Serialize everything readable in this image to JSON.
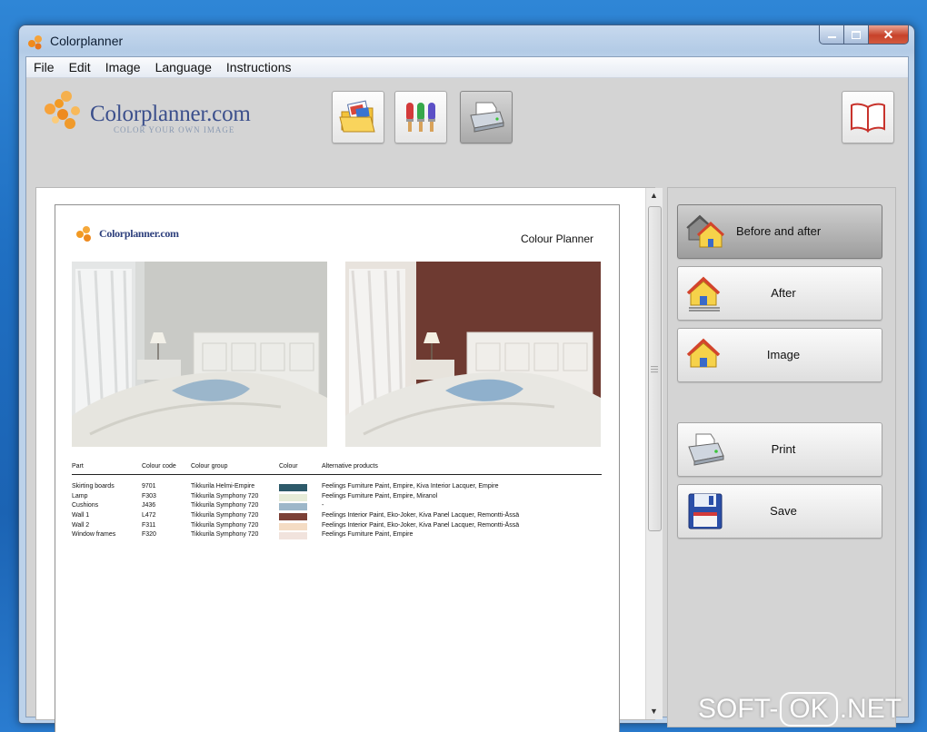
{
  "window": {
    "title": "Colorplanner"
  },
  "menu": [
    "File",
    "Edit",
    "Image",
    "Language",
    "Instructions"
  ],
  "logo": {
    "text": "Colorplanner.com",
    "tagline": "COLOR   YOUR OWN IMAGE"
  },
  "toolbar": [
    {
      "name": "open-image-button",
      "icon": "folder-picture-icon",
      "active": false
    },
    {
      "name": "color-brushes-button",
      "icon": "paint-brushes-icon",
      "active": false
    },
    {
      "name": "print-toolbar-button",
      "icon": "printer-icon",
      "active": true
    },
    {
      "name": "instructions-book-button",
      "icon": "book-icon",
      "active": false
    }
  ],
  "document": {
    "mini_logo": "Colorplanner.com",
    "title": "Colour Planner",
    "table": {
      "headers": [
        "Part",
        "Colour code",
        "Colour group",
        "Colour",
        "Alternative products"
      ],
      "rows": [
        {
          "part": "Skirting boards",
          "code": "9701",
          "group": "Tikkurila Helmi-Empire",
          "colour": "#2d5a6a",
          "alt": "Feelings Furniture Paint, Empire, Kiva Interior Lacquer, Empire"
        },
        {
          "part": "Lamp",
          "code": "F303",
          "group": "Tikkurila Symphony 720",
          "colour": "#e6ecd8",
          "alt": "Feelings Furniture Paint, Empire, Miranol"
        },
        {
          "part": "Cushions",
          "code": "J436",
          "group": "Tikkurila Symphony 720",
          "colour": "#9db7c9",
          "alt": "-"
        },
        {
          "part": "Wall 1",
          "code": "L472",
          "group": "Tikkurila Symphony 720",
          "colour": "#7b4036",
          "alt": "Feelings Interior Paint, Eko-Joker, Kiva Panel Lacquer, Remontti-Ässä"
        },
        {
          "part": "Wall 2",
          "code": "F311",
          "group": "Tikkurila Symphony 720",
          "colour": "#f4dcc4",
          "alt": "Feelings Interior Paint, Eko-Joker, Kiva Panel Lacquer, Remontti-Ässä"
        },
        {
          "part": "Window frames",
          "code": "F320",
          "group": "Tikkurila Symphony 720",
          "colour": "#f1e3dd",
          "alt": "Feelings Furniture Paint, Empire"
        }
      ]
    }
  },
  "actions": {
    "before_after": "Before and after",
    "after": "After",
    "image": "Image",
    "print": "Print",
    "save": "Save"
  },
  "watermark": {
    "left": "SOFT-",
    "ok": "OK",
    "right": ".NET"
  }
}
